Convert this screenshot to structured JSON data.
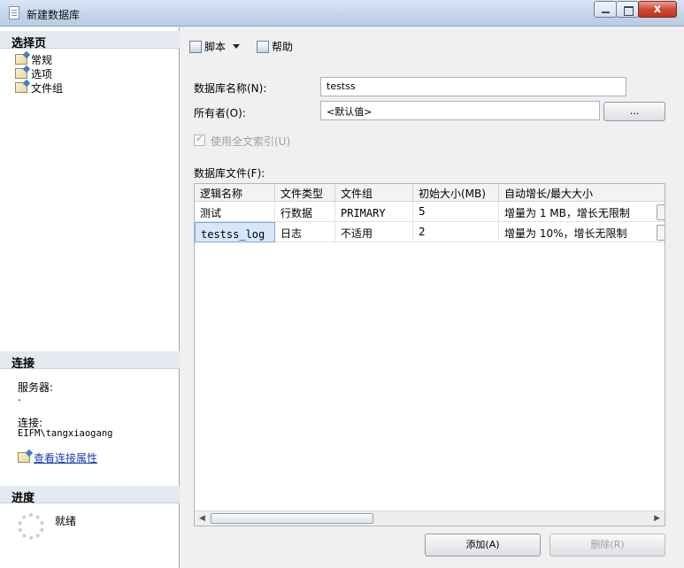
{
  "window": {
    "title": "新建数据库"
  },
  "left": {
    "select_page_header": "选择页",
    "pages": [
      "常规",
      "选项",
      "文件组"
    ],
    "connection_header": "连接",
    "server_label": "服务器:",
    "server_value": ".",
    "connection_label": "连接:",
    "connection_value": "EIFM\\tangxiaogang",
    "view_connection_link": "查看连接属性",
    "progress_header": "进度",
    "progress_status": "就绪"
  },
  "toolbar": {
    "script_label": "脚本",
    "help_label": "帮助"
  },
  "form": {
    "db_name_label": "数据库名称(N):",
    "db_name_value": "testss",
    "owner_label": "所有者(O):",
    "owner_value": "<默认值>",
    "owner_browse_label": "...",
    "fulltext_label": "使用全文索引(U)",
    "db_files_label": "数据库文件(F):"
  },
  "grid": {
    "columns": [
      "逻辑名称",
      "文件类型",
      "文件组",
      "初始大小(MB)",
      "自动增长/最大大小"
    ],
    "rows": [
      {
        "logical": "测试",
        "type": "行数据",
        "group": "PRIMARY",
        "size": "5",
        "growth": "增量为 1 MB，增长无限制"
      },
      {
        "logical": "testss_log",
        "type": "日志",
        "group": "不适用",
        "size": "2",
        "growth": "增量为 10%，增长无限制"
      }
    ]
  },
  "buttons": {
    "add": "添加(A)",
    "remove": "删除(R)"
  }
}
